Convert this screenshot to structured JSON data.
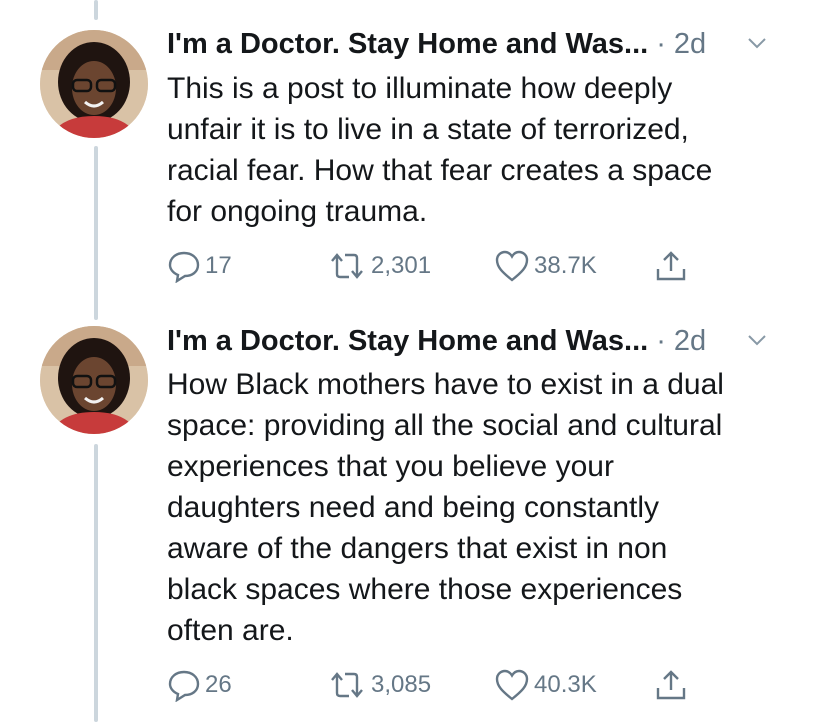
{
  "tweets": [
    {
      "author_name": "I'm a Doctor. Stay Home and Was...",
      "meta": "· 2d",
      "text": "This is a post to illuminate how deeply\nunfair it is to live in a state of terrorized,\nracial fear. How that fear creates a space\nfor ongoing trauma.",
      "replies": "17",
      "retweets": "2,301",
      "likes": "38.7K"
    },
    {
      "author_name": "I'm a Doctor. Stay Home and Was...",
      "meta": "· 2d",
      "text": "How Black mothers have to exist in a dual\nspace: providing all the social and cultural\nexperiences that you believe your\ndaughters need and being constantly\naware of the dangers that exist in non\nblack spaces where those experiences\noften are.",
      "replies": "26",
      "retweets": "3,085",
      "likes": "40.3K"
    }
  ],
  "colors": {
    "text": "#14171a",
    "secondary": "#657786",
    "thread_line": "#ccd6dd"
  },
  "icons": [
    "reply-icon",
    "retweet-icon",
    "like-icon",
    "share-icon",
    "chevron-down-icon"
  ]
}
